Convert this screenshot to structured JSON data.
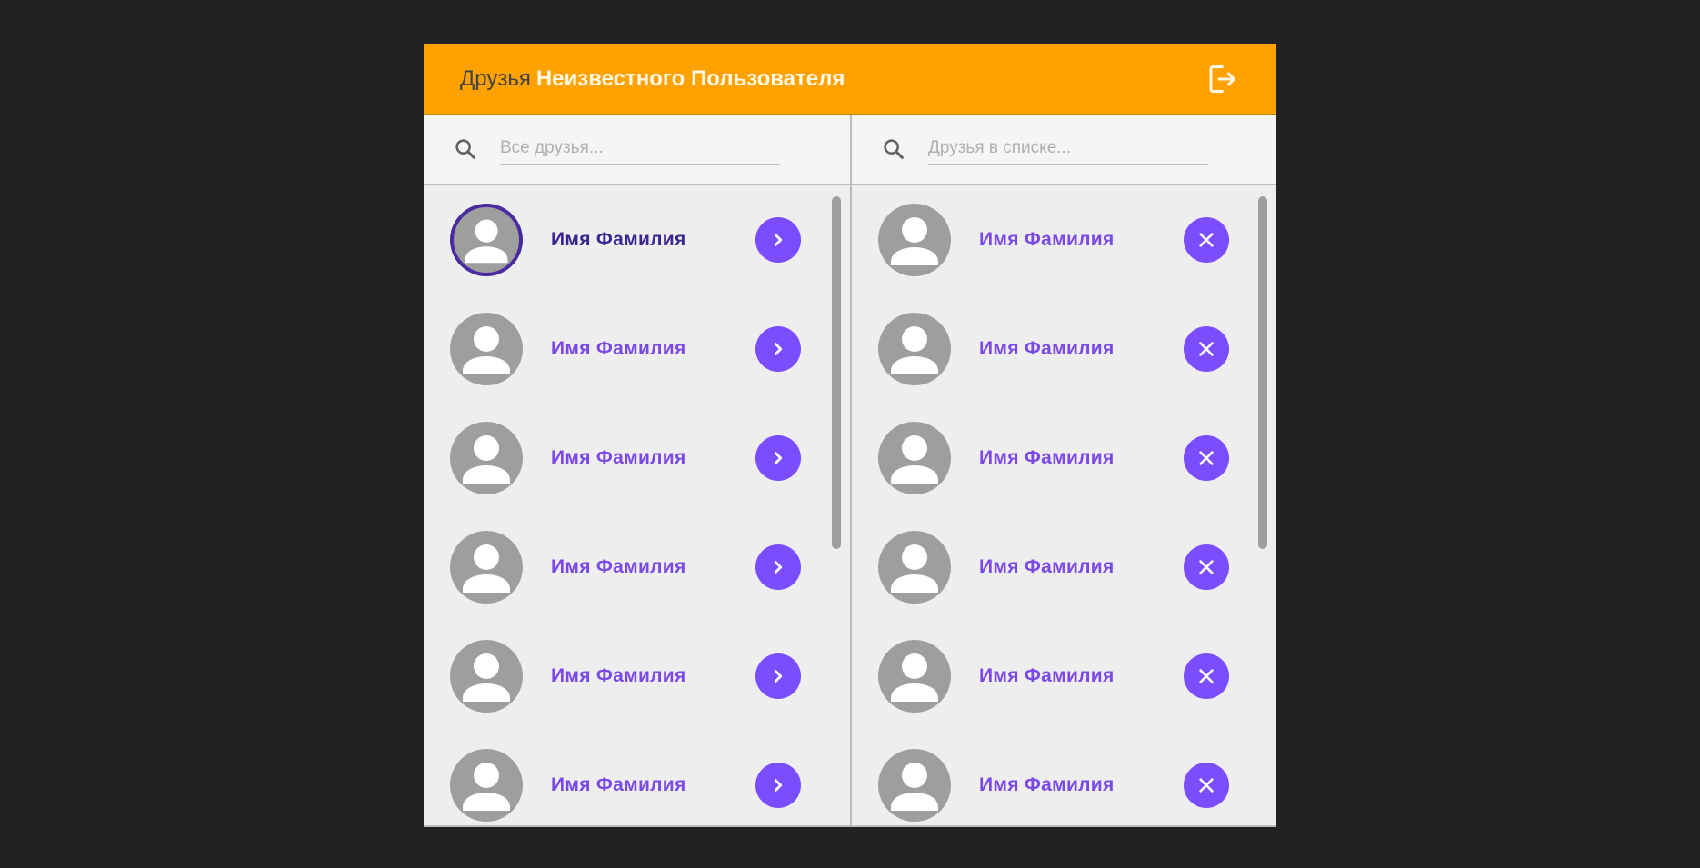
{
  "header": {
    "title_prefix": "Друзья",
    "title_user": "Неизвестного Пользователя",
    "logout_icon": "logout-icon",
    "colors": {
      "bar": "#ffa200",
      "title": "#424242",
      "user": "#fff8e6"
    }
  },
  "left": {
    "search": {
      "placeholder": "Все друзья...",
      "value": "",
      "icon": "search-icon"
    },
    "action_icon": "chevron-right-icon",
    "items": [
      {
        "name": "Имя Фамилия",
        "selected": true
      },
      {
        "name": "Имя Фамилия",
        "selected": false
      },
      {
        "name": "Имя Фамилия",
        "selected": false
      },
      {
        "name": "Имя Фамилия",
        "selected": false
      },
      {
        "name": "Имя Фамилия",
        "selected": false
      },
      {
        "name": "Имя Фамилия",
        "selected": false
      }
    ]
  },
  "right": {
    "search": {
      "placeholder": "Друзья в списке...",
      "value": "",
      "icon": "search-icon"
    },
    "action_icon": "close-icon",
    "items": [
      {
        "name": "Имя Фамилия"
      },
      {
        "name": "Имя Фамилия"
      },
      {
        "name": "Имя Фамилия"
      },
      {
        "name": "Имя Фамилия"
      },
      {
        "name": "Имя Фамилия"
      },
      {
        "name": "Имя Фамилия"
      }
    ]
  },
  "colors": {
    "accent": "#7c4dff",
    "name": "#7b4ae6",
    "selected": "#3d2590",
    "avatar": "#9e9e9e",
    "background": "#222222"
  }
}
